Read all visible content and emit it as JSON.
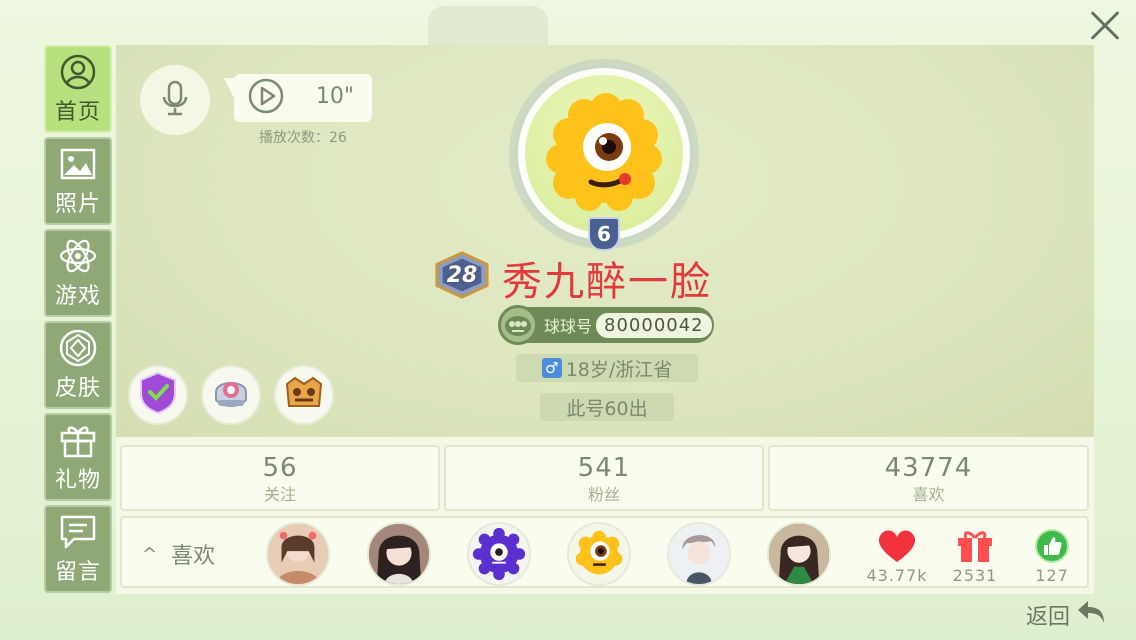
{
  "sidebar": {
    "items": [
      {
        "label": "首页",
        "icon": "user-icon",
        "active": true
      },
      {
        "label": "照片",
        "icon": "photo-icon",
        "active": false
      },
      {
        "label": "游戏",
        "icon": "atom-icon",
        "active": false
      },
      {
        "label": "皮肤",
        "icon": "gem-icon",
        "active": false
      },
      {
        "label": "礼物",
        "icon": "gift-icon",
        "active": false
      },
      {
        "label": "留言",
        "icon": "message-icon",
        "active": false
      }
    ]
  },
  "voice": {
    "duration": "10\"",
    "play_count": "播放次数：26"
  },
  "profile": {
    "level": "6",
    "rank": "28",
    "nickname": "秀九醉一脸",
    "id_label": "球球号",
    "id_value": "80000042",
    "age_location": "18岁/浙江省",
    "motto": "此号60出"
  },
  "stats": [
    {
      "value": "56",
      "label": "关注"
    },
    {
      "value": "541",
      "label": "粉丝"
    },
    {
      "value": "43774",
      "label": "喜欢"
    }
  ],
  "likes": {
    "title": "喜欢",
    "rewards": [
      {
        "icon": "heart-icon",
        "value": "43.77k"
      },
      {
        "icon": "gift-box-icon",
        "value": "2531"
      },
      {
        "icon": "thumbs-up-icon",
        "value": "127"
      }
    ]
  },
  "nav": {
    "back_label": "返回"
  },
  "colors": {
    "sidebar_bg": "#8fa876",
    "sidebar_active": "#b7e07e",
    "nickname": "#e2393a",
    "id_pill": "#6f8a56"
  }
}
